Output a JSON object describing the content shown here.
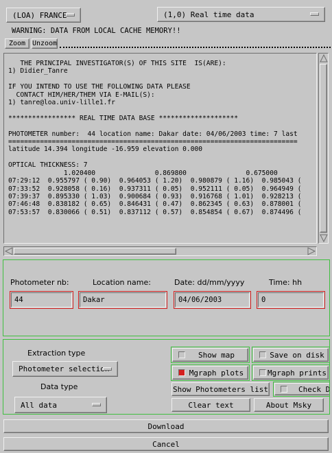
{
  "site_menu": {
    "selected": "(LOA) FRANCE"
  },
  "data_menu": {
    "selected": "(1,0) Real time data"
  },
  "warning": "WARNING: DATA FROM LOCAL CACHE MEMORY!!",
  "zoom_buttons": {
    "zoom": "Zoom",
    "unzoom": "Unzoom"
  },
  "text_lines": [
    "   THE PRINCIPAL INVESTIGATOR(S) OF THIS SITE  IS(ARE):",
    "1) Didier_Tanre",
    "",
    "IF YOU INTEND TO USE THE FOLLOWING DATA PLEASE",
    "  CONTACT HIM/HER/THEM VIA E-MAIL(S):",
    "1) tanre@loa.univ-lille1.fr",
    "",
    "***************** REAL TIME DATA BASE ********************",
    "",
    "PHOTOMETER number:  44 location name: Dakar date: 04/06/2003 time: 7 last",
    "=========================================================================",
    "latitude 14.394 longitude -16.959 elevation 0.000",
    "",
    "OPTICAL THICKNESS: 7",
    "              1.020400               0.869800               0.675000               0.4401",
    "07:29:12  0.955797 ( 0.90)  0.964053 ( 1.20)  0.980879 ( 1.16)  0.985043 (",
    "07:33:52  0.928058 ( 0.16)  0.937311 ( 0.05)  0.952111 ( 0.05)  0.964949 (",
    "07:39:37  0.895330 ( 1.03)  0.900684 ( 0.93)  0.916768 ( 1.01)  0.928213 (",
    "07:46:48  0.838182 ( 0.65)  0.846431 ( 0.47)  0.862345 ( 0.63)  0.878001 (",
    "07:53:57  0.830066 ( 0.51)  0.837112 ( 0.57)  0.854854 ( 0.67)  0.874496 ("
  ],
  "form": {
    "photometer_label": "Photometer nb:",
    "photometer_value": "44",
    "location_label": "Location name:",
    "location_value": "Dakar",
    "date_label": "Date: dd/mm/yyyy",
    "date_value": "04/06/2003",
    "time_label": "Time: hh",
    "time_value": "0"
  },
  "options": {
    "extraction_label": "Extraction type",
    "extraction_selected": "Photometer selection",
    "datatype_label": "Data type",
    "datatype_selected": "All data",
    "show_map": "Show map",
    "save_on_disk": "Save on disk",
    "mgraph_plots": "Mgraph plots",
    "mgraph_prints": "Mgraph prints",
    "show_photometers_list": "Show Photometers list",
    "check_db": "Check DB",
    "clear_text": "Clear text",
    "about": "About Msky",
    "mgraph_plots_checked": true,
    "show_map_checked": false,
    "save_on_disk_checked": false,
    "mgraph_prints_checked": false,
    "check_db_checked": false
  },
  "download": "Download",
  "cancel": "Cancel",
  "colors": {
    "background": "#c6c6c6",
    "frame_green": "#3fbf3f",
    "field_red": "#d42020"
  }
}
